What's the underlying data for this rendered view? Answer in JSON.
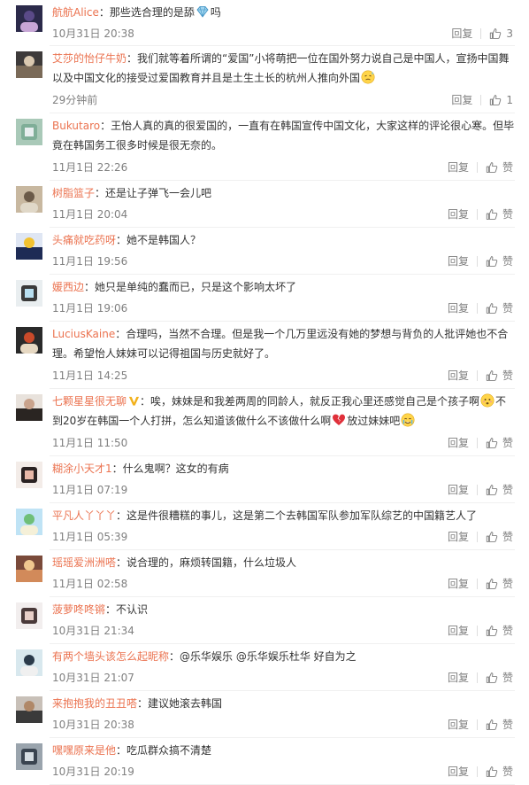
{
  "icons": {
    "like": "thumbs-up-icon",
    "verified": "verified-v-icon"
  },
  "colors": {
    "username": "#eb7350",
    "meta": "#808080",
    "text": "#333333"
  },
  "comments": [
    {
      "name": "航航Alice",
      "pre": "：那些选合理的是舔",
      "emoji": "diamond-emoji-icon",
      "post": "吗",
      "time": "10月31日 20:38",
      "reply": "回复",
      "likes": "3",
      "avatar": [
        "#2b2a4a",
        "#5a4a88",
        "#c7a6d6"
      ]
    },
    {
      "name": "艾莎的怡仔牛奶",
      "pre": "：我们就等着所谓的“爱国”小将萌把一位在国外努力说自己是中国人，宣扬中国舞以及中国文化的接受过爱国教育并且是土生土长的杭州人推向外国",
      "emoji": "sweat-emoji-icon",
      "post": "",
      "time": "29分钟前",
      "reply": "回复",
      "likes": "1",
      "avatar": [
        "#3d3a3a",
        "#7a6a58",
        "#d9c8b0"
      ]
    },
    {
      "name": "Bukutaro",
      "pre": "：王怡人真的真的很爱国的，一直有在韩国宣传中国文化，大家这样的评论很心寒。但毕竟在韩国务工很多时候是很无奈的。",
      "emoji": "",
      "post": "",
      "time": "11月1日 22:26",
      "reply": "回复",
      "likes": "赞",
      "avatar": [
        "#a9c9b8",
        "#7fae98",
        "#e8eef0"
      ]
    },
    {
      "name": "树脂篮子",
      "pre": "：还是让子弹飞一会儿吧",
      "emoji": "",
      "post": "",
      "time": "11月1日 20:04",
      "reply": "回复",
      "likes": "赞",
      "avatar": [
        "#c8b8a0",
        "#6b5a48",
        "#e0d8c8"
      ]
    },
    {
      "name": "头痛就吃药呀",
      "pre": "：她不是韩国人？",
      "emoji": "",
      "post": "",
      "time": "11月1日 19:56",
      "reply": "回复",
      "likes": "赞",
      "avatar": [
        "#dfe6f3",
        "#1e2b55",
        "#f2c230"
      ]
    },
    {
      "name": "媛西边",
      "pre": "：她只是单纯的蠢而已，只是这个影响太坏了",
      "emoji": "",
      "post": "",
      "time": "11月1日 19:06",
      "reply": "回复",
      "likes": "赞",
      "avatar": [
        "#e9eef0",
        "#3a3a3a",
        "#b8dff0"
      ]
    },
    {
      "name": "LuciusKaine",
      "pre": "：合理吗，当然不合理。但是我一个几万里远没有她的梦想与背负的人批评她也不合理。希望怡人妹妹可以记得祖国与历史就好了。",
      "emoji": "",
      "post": "",
      "time": "11月1日 14:25",
      "reply": "回复",
      "likes": "赞",
      "avatar": [
        "#2a2a2a",
        "#c94a2a",
        "#e6d8c2"
      ]
    },
    {
      "name": "七颗星星很无聊",
      "badge": true,
      "pre": "：唉，妹妹是和我差两周的同龄人，就反正我心里还感觉自己是个孩子啊",
      "emoji": "awkward-emoji-icon",
      "post": "不到20岁在韩国一个人打拼，怎么知道该做什么不该做什么啊",
      "emoji2": "broken-heart-icon",
      "post2": "放过妹妹吧",
      "emoji3": "crying-emoji-icon",
      "time": "11月1日 11:50",
      "reply": "回复",
      "likes": "赞",
      "avatar": [
        "#e8e2dc",
        "#2a2522",
        "#c9a38c"
      ]
    },
    {
      "name": "糊涂小天才1",
      "pre": "：什么鬼啊？这女的有病",
      "emoji": "",
      "post": "",
      "time": "11月1日 07:19",
      "reply": "回复",
      "likes": "赞",
      "avatar": [
        "#f3ece8",
        "#2a2222",
        "#e8b8a8"
      ]
    },
    {
      "name": "平凡人丫丫丫",
      "pre": "：这是件很糟糕的事儿，这是第二个去韩国军队参加军队综艺的中国籍艺人了",
      "emoji": "",
      "post": "",
      "time": "11月1日 05:39",
      "reply": "回复",
      "likes": "赞",
      "avatar": [
        "#bfe3f5",
        "#6fbf78",
        "#f5f0d8"
      ]
    },
    {
      "name": "瑶瑶爱洲洲嗒",
      "pre": "：说合理的，麻烦转国籍，什么垃圾人",
      "emoji": "",
      "post": "",
      "time": "11月1日 02:58",
      "reply": "回复",
      "likes": "赞",
      "avatar": [
        "#7a4a3a",
        "#d28a5a",
        "#f0c890"
      ]
    },
    {
      "name": "菠萝咚咚锵",
      "pre": "：不认识",
      "emoji": "",
      "post": "",
      "time": "10月31日 21:34",
      "reply": "回复",
      "likes": "赞",
      "avatar": [
        "#f2eeee",
        "#4a3a3a",
        "#e8cfc8"
      ]
    },
    {
      "name": "有两个墙头该怎么起昵称",
      "pre": "：@乐华娱乐 @乐华娱乐杜华 好自为之",
      "emoji": "",
      "post": "",
      "time": "10月31日 21:07",
      "reply": "回复",
      "likes": "赞",
      "avatar": [
        "#d8e8ee",
        "#2a3a4a",
        "#f0f0f0"
      ]
    },
    {
      "name": "来抱抱我的丑丑嗒",
      "pre": "：建议她滚去韩国",
      "emoji": "",
      "post": "",
      "time": "10月31日 20:38",
      "reply": "回复",
      "likes": "赞",
      "avatar": [
        "#c8c0b8",
        "#3a3a3a",
        "#b08868"
      ]
    },
    {
      "name": "嘿嘿原来是他",
      "pre": "：吃瓜群众搞不清楚",
      "emoji": "",
      "post": "",
      "time": "10月31日 20:19",
      "reply": "回复",
      "likes": "赞",
      "avatar": [
        "#9aa4ad",
        "#3a4450",
        "#d6dde2"
      ]
    }
  ]
}
